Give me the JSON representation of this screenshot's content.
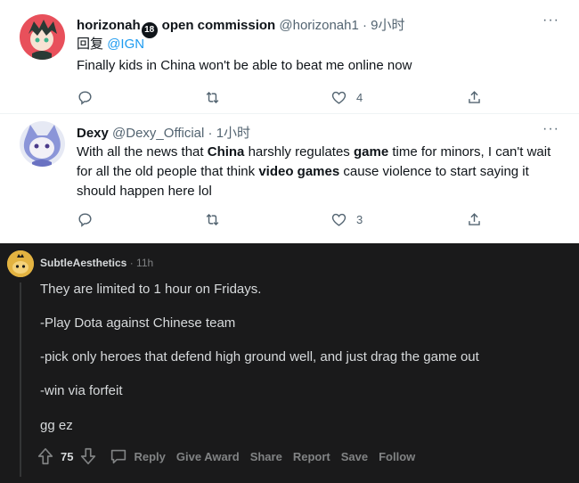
{
  "tweets": [
    {
      "display_name": "horizonah",
      "badge": "18",
      "name_suffix": "open commission",
      "handle": "@horizonah1",
      "time": "9小时",
      "reply_prefix": "回复",
      "reply_to": "@IGN",
      "text": "Finally kids in China won't be able to beat me online now",
      "likes": "4"
    },
    {
      "display_name": "Dexy",
      "handle": "@Dexy_Official",
      "time": "1小时",
      "text_parts": [
        "With all the news that ",
        "China",
        " harshly regulates ",
        "game",
        " time for minors, I can't wait for all the old people that think ",
        "video games",
        " cause violence to start saying it should happen here lol"
      ],
      "likes": "3"
    }
  ],
  "more_label": "···",
  "separator": " · ",
  "reddit": {
    "username": "SubtleAesthetics",
    "time": "11h",
    "paragraphs": [
      "They are limited to 1 hour on Fridays.",
      "-Play Dota against Chinese team",
      "-pick only heroes that defend high ground well, and just drag the game out",
      "-win via forfeit",
      "gg ez"
    ],
    "score": "75",
    "actions": [
      "Reply",
      "Give Award",
      "Share",
      "Report",
      "Save",
      "Follow"
    ]
  },
  "colors": {
    "twitter_text": "#0f1419",
    "twitter_muted": "#536471",
    "twitter_link": "#1d9bf0",
    "reddit_bg": "#1a1a1b",
    "reddit_text": "#d7dadc",
    "reddit_muted": "#818384",
    "badge_red": "#e0245e"
  }
}
